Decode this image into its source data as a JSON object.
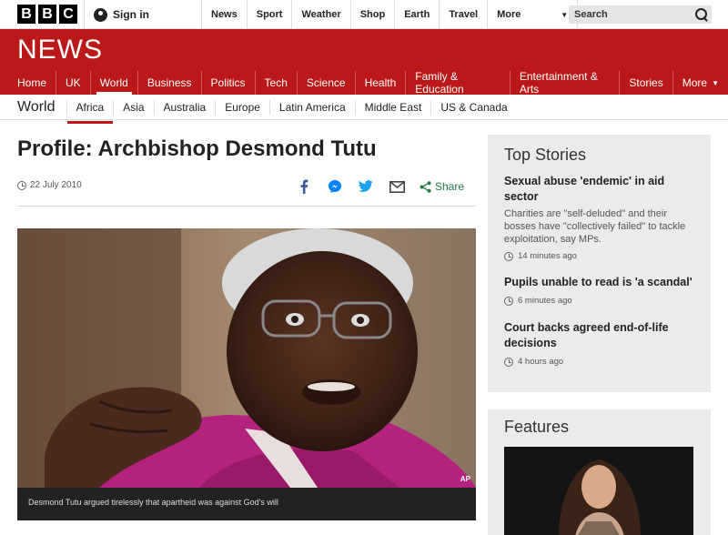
{
  "topbar": {
    "logo_letters": [
      "B",
      "B",
      "C"
    ],
    "signin_label": "Sign in",
    "nav": [
      "News",
      "Sport",
      "Weather",
      "Shop",
      "Earth",
      "Travel"
    ],
    "more_label": "More",
    "search_placeholder": "Search"
  },
  "masthead": {
    "title": "NEWS",
    "accent": "#bb1919"
  },
  "mainnav": {
    "items": [
      "Home",
      "UK",
      "World",
      "Business",
      "Politics",
      "Tech",
      "Science",
      "Health",
      "Family & Education",
      "Entertainment & Arts",
      "Stories"
    ],
    "more_label": "More",
    "active": "World"
  },
  "subnav": {
    "section": "World",
    "items": [
      "Africa",
      "Asia",
      "Australia",
      "Europe",
      "Latin America",
      "Middle East",
      "US & Canada"
    ],
    "active": "Africa"
  },
  "article": {
    "headline": "Profile: Archbishop Desmond Tutu",
    "date": "22 July 2010",
    "share_label": "Share",
    "image_credit": "AP",
    "caption": "Desmond Tutu argued tirelessly that apartheid was against God's will"
  },
  "sidebar": {
    "top_stories_title": "Top Stories",
    "stories": [
      {
        "title": "Sexual abuse 'endemic' in aid sector",
        "summary": "Charities are \"self-deluded\" and their bosses have \"collectively failed\" to tackle exploitation, say MPs.",
        "time": "14 minutes ago"
      },
      {
        "title": "Pupils unable to read is 'a scandal'",
        "summary": "",
        "time": "6 minutes ago"
      },
      {
        "title": "Court backs agreed end-of-life decisions",
        "summary": "",
        "time": "4 hours ago"
      }
    ],
    "features_title": "Features"
  }
}
